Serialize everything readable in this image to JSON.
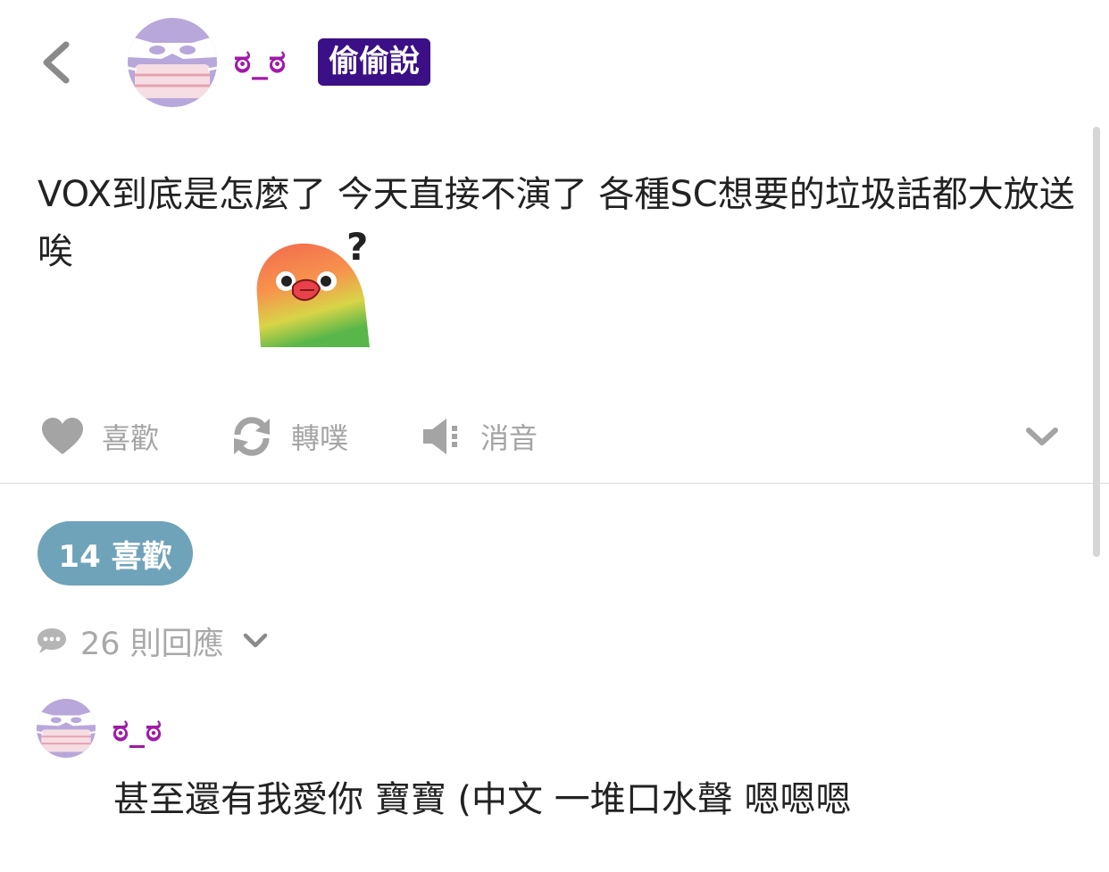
{
  "header": {
    "display_name": "ಠ_ಠ",
    "qualifier": "偷偷說",
    "avatar_icon": "anonymous-masked-face-icon"
  },
  "post": {
    "content": "VOX到底是怎麼了 今天直接不演了 各種SC想要的垃圾話都大放送唉",
    "sticker_icon": "lovebird-question-sticker"
  },
  "actions": {
    "like_label": "喜歡",
    "replurk_label": "轉噗",
    "mute_label": "消音"
  },
  "likes_pill": {
    "label": "14 喜歡"
  },
  "responses": {
    "label": "26 則回應"
  },
  "reply": {
    "display_name": "ಠ_ಠ",
    "content": "甚至還有我愛你 寶寶 (中文 一堆口水聲 嗯嗯嗯"
  },
  "colors": {
    "name": "#a01aa8",
    "qualifier_bg": "#3b0f85",
    "pill_bg": "#6fa3b9",
    "action_gray": "#a4a4a4",
    "avatar_purple": "#b8a7da"
  }
}
